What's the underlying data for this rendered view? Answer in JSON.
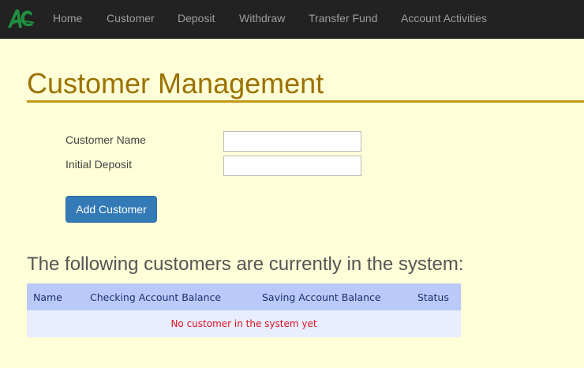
{
  "nav": {
    "brand_alt": "AC",
    "items": [
      {
        "label": "Home"
      },
      {
        "label": "Customer"
      },
      {
        "label": "Deposit"
      },
      {
        "label": "Withdraw"
      },
      {
        "label": "Transfer Fund"
      },
      {
        "label": "Account Activities"
      }
    ]
  },
  "page": {
    "title": "Customer Management"
  },
  "form": {
    "customer_name_label": "Customer Name",
    "customer_name_value": "",
    "initial_deposit_label": "Initial Deposit",
    "initial_deposit_value": "",
    "submit_label": "Add Customer"
  },
  "customers": {
    "heading": "The following customers are currently in the system:",
    "columns": [
      "Name",
      "Checking Account Balance",
      "Saving Account Balance",
      "Status"
    ],
    "rows": [],
    "empty_message": "No customer in the system yet"
  },
  "colors": {
    "nav_background": "#222222",
    "page_background": "#fefed8",
    "title_color": "#9b7200",
    "button_primary": "#337ab7",
    "table_header": "#b9c9f9",
    "table_row": "#e8eefe",
    "empty_message": "#dd1122"
  }
}
